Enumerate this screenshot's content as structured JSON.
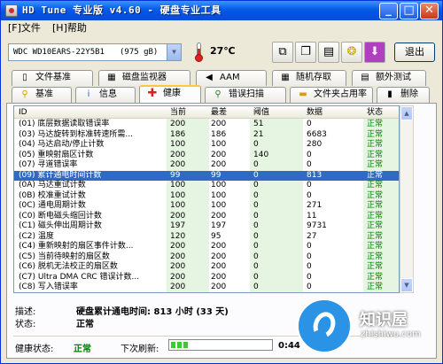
{
  "window": {
    "title": "HD Tune 专业版 v4.60 - 硬盘专业工具"
  },
  "menu": [
    "[F]文件",
    "[H]帮助"
  ],
  "toolbar": {
    "drive": "WDC WD10EARS-22Y5B1",
    "drive_size": "(975 gB)",
    "temperature": "27℃",
    "exit_label": "退出",
    "icons": [
      "copy-icon",
      "copy-text-icon",
      "save-icon",
      "options-icon",
      "download-icon"
    ]
  },
  "tabs_top": [
    "文件基准",
    "磁盘监视器",
    "AAM",
    "随机存取",
    "额外测试"
  ],
  "tabs_bottom": [
    "基准",
    "信息",
    "健康",
    "错误扫描",
    "文件夹占用率",
    "删除"
  ],
  "active_tab": "健康",
  "table": {
    "headers": [
      "ID",
      "当前",
      "最差",
      "阈值",
      "数据",
      "状态"
    ],
    "rows": [
      [
        "(01) 底层数据读取错误率",
        "200",
        "200",
        "51",
        "0",
        "正常"
      ],
      [
        "(03) 马达旋转到标准转速所需...",
        "186",
        "186",
        "21",
        "6683",
        "正常"
      ],
      [
        "(04) 马达启动/停止计数",
        "100",
        "100",
        "0",
        "280",
        "正常"
      ],
      [
        "(05) 重映射扇区计数",
        "200",
        "200",
        "140",
        "0",
        "正常"
      ],
      [
        "(07) 寻道错误率",
        "200",
        "200",
        "0",
        "0",
        "正常"
      ],
      [
        "(09) 累计通电时间计数",
        "99",
        "99",
        "0",
        "813",
        "正常"
      ],
      [
        "(0A) 马达重试计数",
        "100",
        "100",
        "0",
        "0",
        "正常"
      ],
      [
        "(0B) 校准重试计数",
        "100",
        "100",
        "0",
        "0",
        "正常"
      ],
      [
        "(0C) 通电周期计数",
        "100",
        "100",
        "0",
        "271",
        "正常"
      ],
      [
        "(C0) 断电磁头缩回计数",
        "200",
        "200",
        "0",
        "11",
        "正常"
      ],
      [
        "(C1) 磁头伸出周期计数",
        "197",
        "197",
        "0",
        "9731",
        "正常"
      ],
      [
        "(C2) 温度",
        "120",
        "95",
        "0",
        "27",
        "正常"
      ],
      [
        "(C4) 重新映射的扇区事件计数...",
        "200",
        "200",
        "0",
        "0",
        "正常"
      ],
      [
        "(C5) 当前待映射的扇区数",
        "200",
        "200",
        "0",
        "0",
        "正常"
      ],
      [
        "(C6) 脱机无法校正的扇区数",
        "200",
        "200",
        "0",
        "0",
        "正常"
      ],
      [
        "(C7) Ultra DMA CRC 错误计数...",
        "200",
        "200",
        "0",
        "0",
        "正常"
      ],
      [
        "(C8) 写入错误率",
        "200",
        "200",
        "0",
        "0",
        "正常"
      ]
    ],
    "selected_index": 5
  },
  "details": {
    "desc_label": "描述:",
    "desc_value": "硬盘累计通电时间: 813 小时 (33 天)",
    "state_label": "状态:",
    "state_value": "正常"
  },
  "status": {
    "health_label": "健康状态:",
    "health_value": "正常",
    "refresh_label": "下次刷新:",
    "countdown": "0:44"
  },
  "watermark": {
    "name": "知识屋",
    "url": "zhishiwu.com"
  },
  "colors": {
    "selection": "#316ac5",
    "ok_green": "#008000",
    "titlebar": "#0054e3"
  }
}
